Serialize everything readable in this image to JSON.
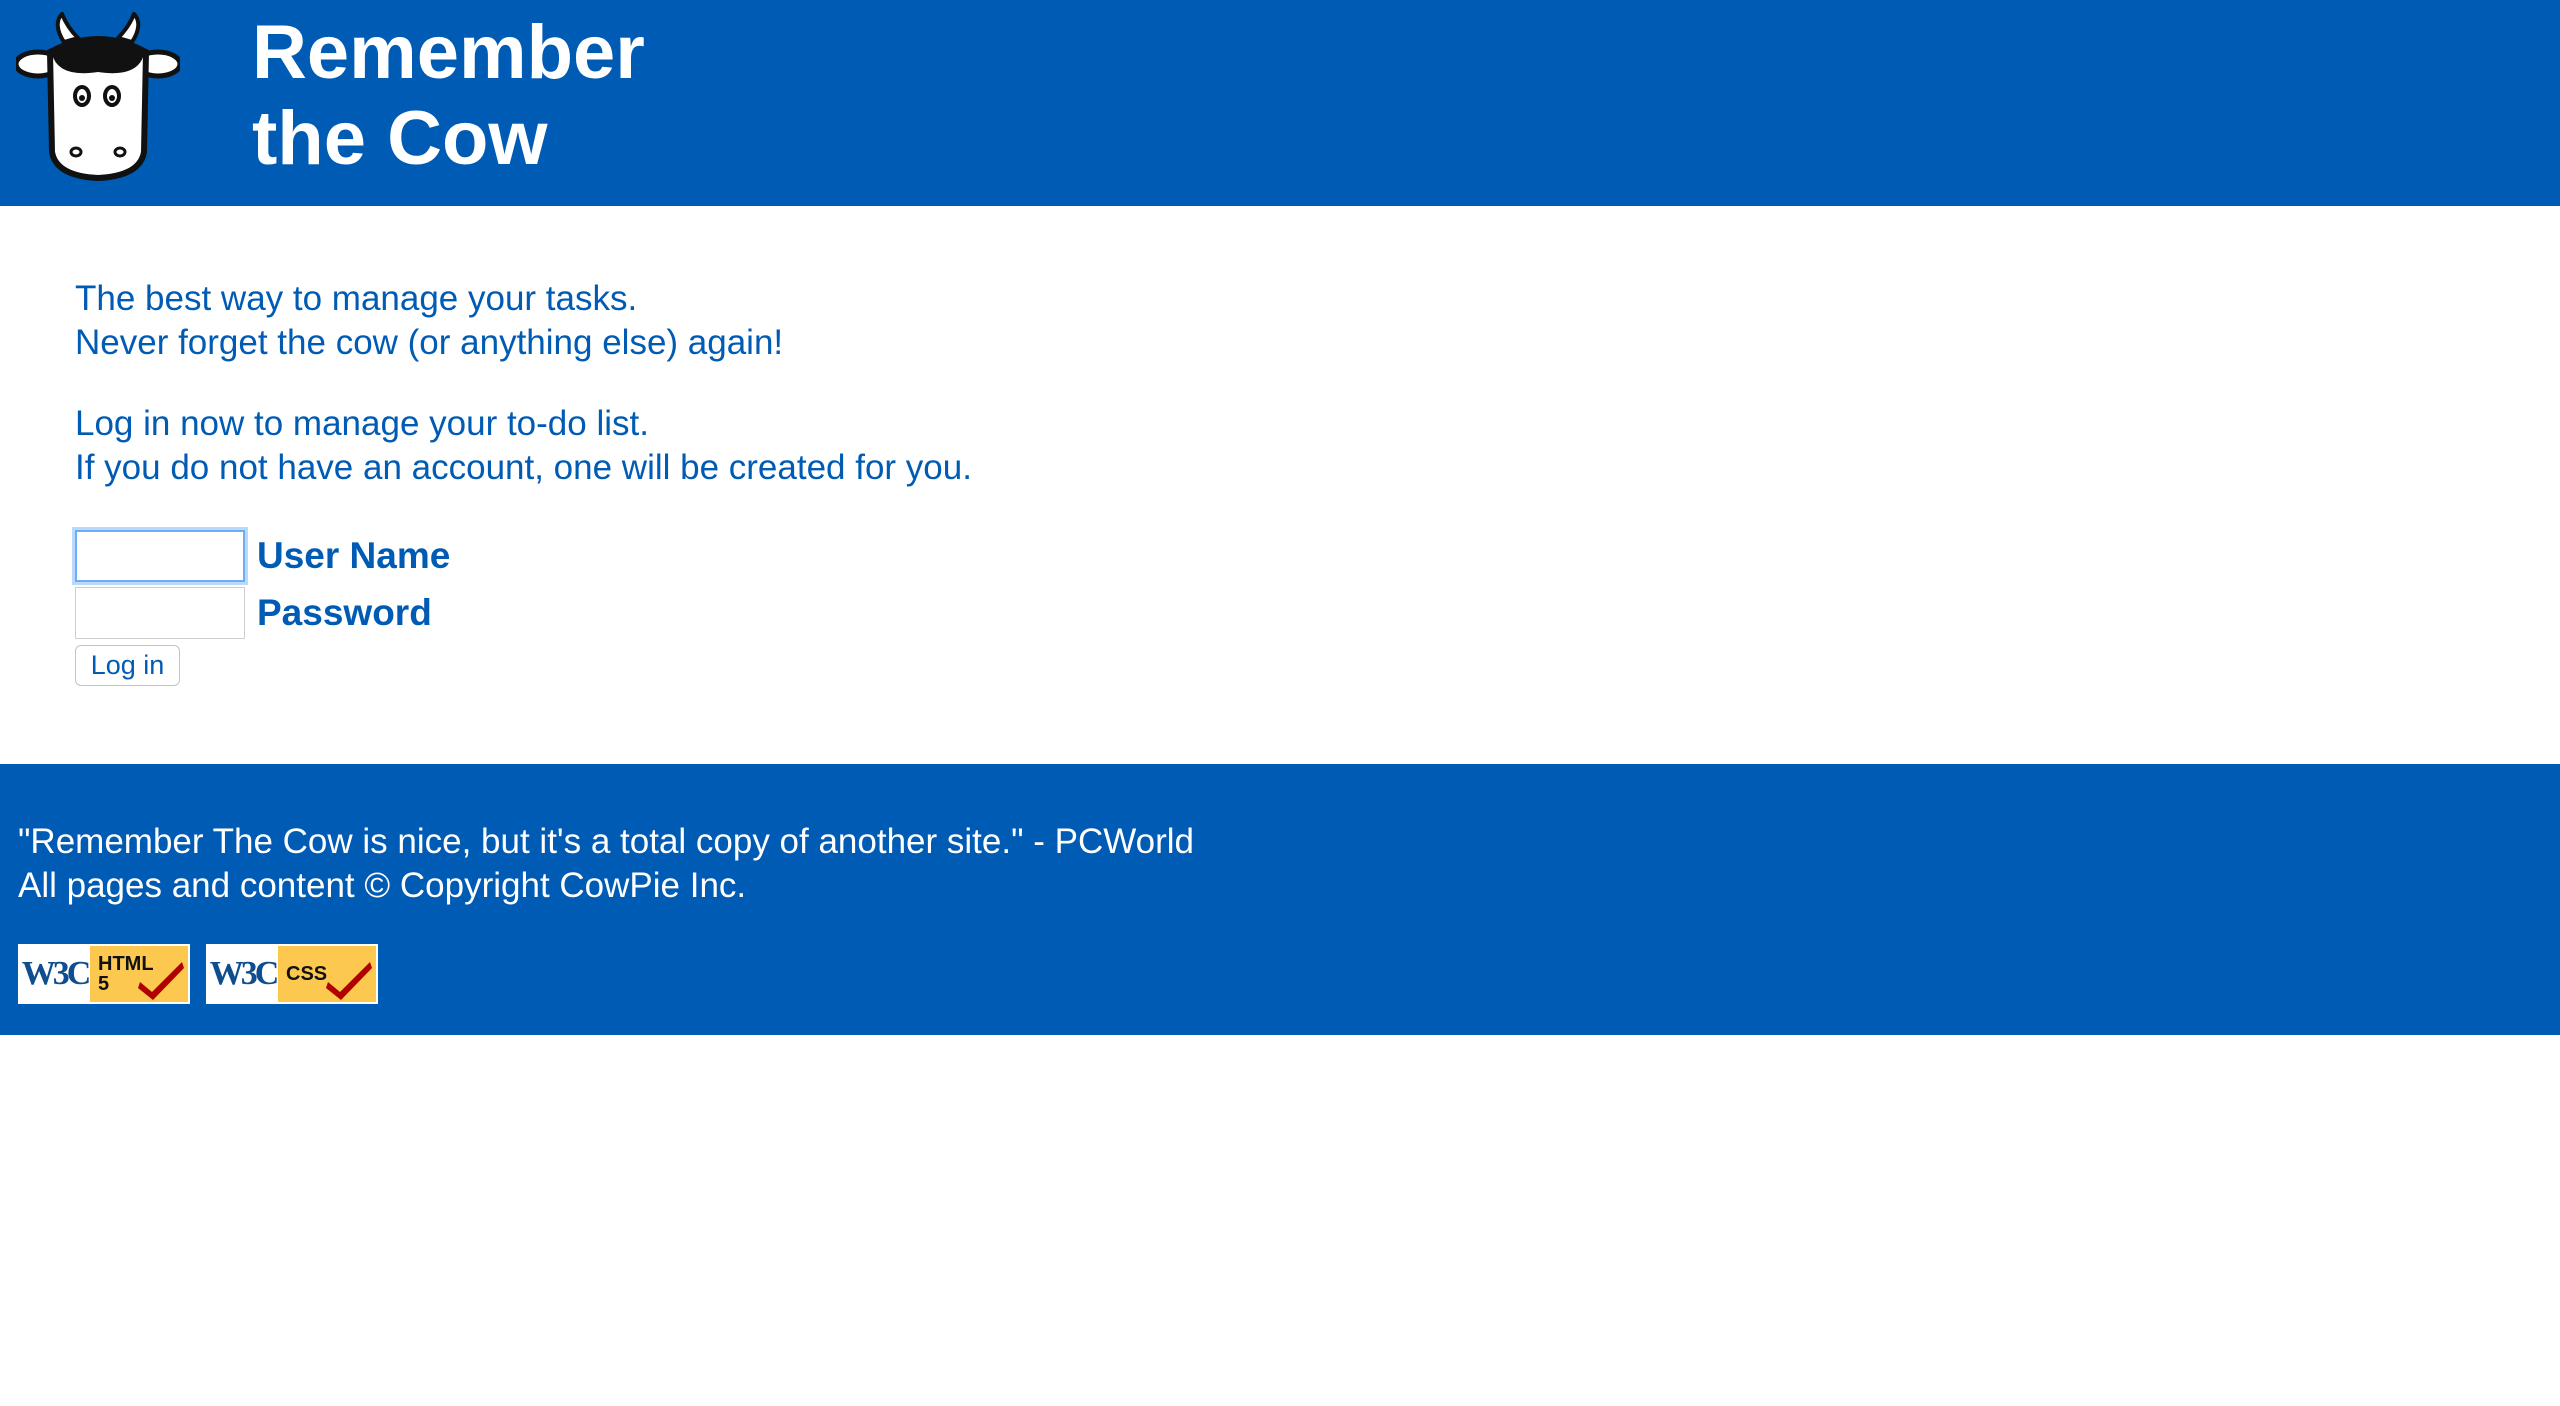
{
  "header": {
    "title_line1": "Remember",
    "title_line2": "the Cow",
    "logo_icon": "cow-face-icon",
    "background": "#005bb4"
  },
  "intro": {
    "line1": "The best way to manage your tasks.",
    "line2": "Never forget the cow (or anything else) again!",
    "line3": "Log in now to manage your to-do list.",
    "line4": "If you do not have an account, one will be created for you."
  },
  "login": {
    "username_label": "User Name",
    "username_value": "",
    "password_label": "Password",
    "password_value": "",
    "button_label": "Log in"
  },
  "footer": {
    "quote": "\"Remember The Cow is nice, but it's a total copy of another site.\" - PCWorld",
    "copyright": "All pages and content © Copyright CowPie Inc.",
    "badges": [
      {
        "w3c": "W3C",
        "tech": "HTML",
        "tech_sub": "5",
        "icon": "check-icon"
      },
      {
        "w3c": "W3C",
        "tech": "CSS",
        "tech_sub": "",
        "icon": "check-icon"
      }
    ]
  },
  "colors": {
    "brand_blue": "#005bb4",
    "badge_gold": "#fcc84f",
    "check_red": "#b00000"
  }
}
